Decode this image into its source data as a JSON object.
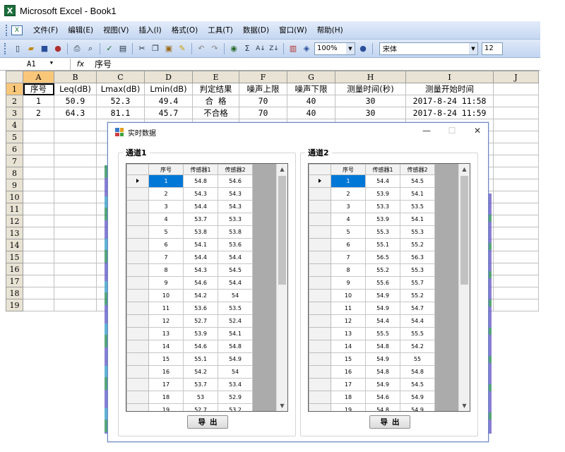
{
  "excel": {
    "title": "Microsoft Excel - Book1",
    "app_icon": "X",
    "doc_icon": "X",
    "menu": [
      "文件(F)",
      "编辑(E)",
      "视图(V)",
      "插入(I)",
      "格式(O)",
      "工具(T)",
      "数据(D)",
      "窗口(W)",
      "帮助(H)"
    ],
    "toolbar": {
      "zoom": "100%",
      "font": "宋体",
      "size": "12",
      "icons": [
        "new-icon",
        "open-icon",
        "save-icon",
        "permission-icon",
        "print-icon",
        "print-preview-icon",
        "spelling-icon",
        "research-icon",
        "cut-icon",
        "copy-icon",
        "paste-icon",
        "format-painter-icon",
        "undo-icon",
        "redo-icon",
        "hyperlink-icon",
        "autosum-icon",
        "sort-ascending-icon",
        "sort-descending-icon",
        "chart-wizard-icon",
        "drawing-icon",
        "help-icon"
      ]
    },
    "name_box": "A1",
    "fx": "fx",
    "formula_value": "序号",
    "columns": [
      "A",
      "B",
      "C",
      "D",
      "E",
      "F",
      "G",
      "H",
      "I",
      "J"
    ],
    "rows": [
      "1",
      "2",
      "3",
      "4",
      "5",
      "6",
      "7",
      "8",
      "9",
      "10",
      "11",
      "12",
      "13",
      "14",
      "15",
      "16",
      "17",
      "18",
      "19"
    ],
    "cells": [
      [
        "序号",
        "Leq(dB)",
        "Lmax(dB)",
        "Lmin(dB)",
        "判定结果",
        "噪声上限",
        "噪声下限",
        "测量时间(秒)",
        "测量开始时间",
        ""
      ],
      [
        "1",
        "50.9",
        "52.3",
        "49.4",
        "合  格",
        "70",
        "40",
        "30",
        "2017-8-24 11:58",
        ""
      ],
      [
        "2",
        "64.3",
        "81.1",
        "45.7",
        "不合格",
        "70",
        "40",
        "30",
        "2017-8-24 11:59",
        ""
      ]
    ]
  },
  "dialog": {
    "title": "实时数据",
    "window_buttons": {
      "minimize": "—",
      "maximize": "☐",
      "close": "✕"
    },
    "channels": [
      {
        "title": "通道1",
        "headers": [
          "序号",
          "传感器1",
          "传感器2"
        ],
        "rows": [
          [
            "1",
            "54.8",
            "54.6"
          ],
          [
            "2",
            "54.3",
            "54.3"
          ],
          [
            "3",
            "54.4",
            "54.3"
          ],
          [
            "4",
            "53.7",
            "53.3"
          ],
          [
            "5",
            "53.8",
            "53.8"
          ],
          [
            "6",
            "54.1",
            "53.6"
          ],
          [
            "7",
            "54.4",
            "54.4"
          ],
          [
            "8",
            "54.3",
            "54.5"
          ],
          [
            "9",
            "54.6",
            "54.4"
          ],
          [
            "10",
            "54.2",
            "54"
          ],
          [
            "11",
            "53.6",
            "53.5"
          ],
          [
            "12",
            "52.7",
            "52.4"
          ],
          [
            "13",
            "53.9",
            "54.1"
          ],
          [
            "14",
            "54.6",
            "54.8"
          ],
          [
            "15",
            "55.1",
            "54.9"
          ],
          [
            "16",
            "54.2",
            "54"
          ],
          [
            "17",
            "53.7",
            "53.4"
          ],
          [
            "18",
            "53",
            "52.9"
          ],
          [
            "19",
            "52.7",
            "53.2"
          ]
        ],
        "export_label": "导出"
      },
      {
        "title": "通道2",
        "headers": [
          "序号",
          "传感器1",
          "传感器2"
        ],
        "rows": [
          [
            "1",
            "54.4",
            "54.5"
          ],
          [
            "2",
            "53.9",
            "54.1"
          ],
          [
            "3",
            "53.3",
            "53.5"
          ],
          [
            "4",
            "53.9",
            "54.1"
          ],
          [
            "5",
            "55.3",
            "55.3"
          ],
          [
            "6",
            "55.1",
            "55.2"
          ],
          [
            "7",
            "56.5",
            "56.3"
          ],
          [
            "8",
            "55.2",
            "55.3"
          ],
          [
            "9",
            "55.6",
            "55.7"
          ],
          [
            "10",
            "54.9",
            "55.2"
          ],
          [
            "11",
            "54.9",
            "54.7"
          ],
          [
            "12",
            "54.4",
            "54.4"
          ],
          [
            "13",
            "55.5",
            "55.5"
          ],
          [
            "14",
            "54.8",
            "54.2"
          ],
          [
            "15",
            "54.9",
            "55"
          ],
          [
            "16",
            "54.8",
            "54.8"
          ],
          [
            "17",
            "54.9",
            "54.5"
          ],
          [
            "18",
            "54.6",
            "54.9"
          ],
          [
            "19",
            "54.8",
            "54.9"
          ]
        ],
        "export_label": "导出"
      }
    ]
  }
}
